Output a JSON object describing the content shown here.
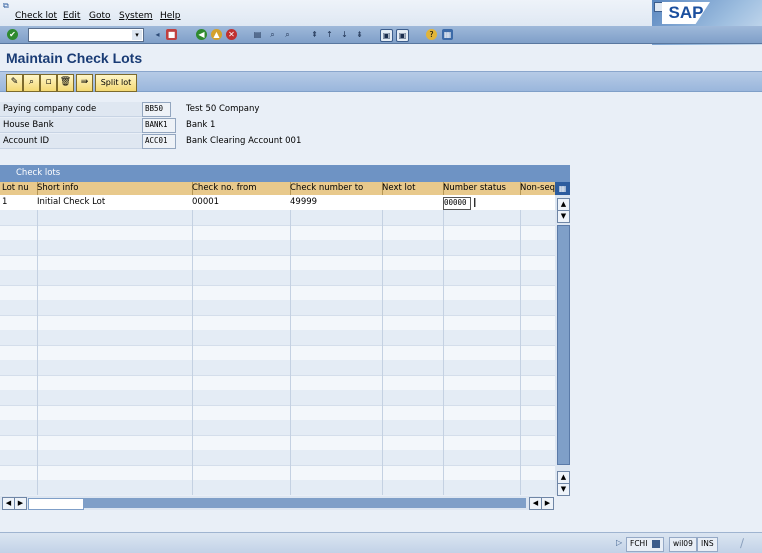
{
  "menu": {
    "items": [
      "Check lot",
      "Edit",
      "Goto",
      "System",
      "Help"
    ]
  },
  "brand": {
    "logo": "SAP"
  },
  "toolbar": {
    "command_field_value": "",
    "icons": [
      "enter-icon",
      "back-icon",
      "exit-icon",
      "cancel-icon",
      "print-icon",
      "find-icon",
      "find-next-icon",
      "first-page-icon",
      "prev-page-icon",
      "next-page-icon",
      "last-page-icon",
      "new-session-icon",
      "shortcut-icon",
      "help-icon",
      "layout-icon"
    ]
  },
  "page": {
    "title": "Maintain Check Lots"
  },
  "app_toolbar": {
    "split_lot_label": "Split lot",
    "icons": [
      "change-icon",
      "display-icon",
      "create-icon",
      "delete-icon",
      "next-icon"
    ]
  },
  "header_fields": {
    "paying_company_code": {
      "label": "Paying company code",
      "value": "BB50",
      "description": "Test 50 Company"
    },
    "house_bank": {
      "label": "House Bank",
      "value": "BANK1",
      "description": "Bank 1"
    },
    "account_id": {
      "label": "Account ID",
      "value": "ACC01",
      "description": "Bank Clearing Account 001"
    }
  },
  "check_lots_table": {
    "title": "Check lots",
    "columns": [
      "Lot nu",
      "Short info",
      "Check no. from",
      "Check number to",
      "Next lot",
      "Number status",
      "Non-seq"
    ],
    "rows": [
      {
        "lot_number": "1",
        "short_info": "Initial Check Lot",
        "check_no_from": "00001",
        "check_number_to": "49999",
        "next_lot": "",
        "number_status": "00000",
        "non_seq": ""
      }
    ]
  },
  "status_bar": {
    "system": "FCHI",
    "server": "wil09",
    "mode": "INS"
  },
  "colors": {
    "title_text": "#1a3c75",
    "table_header": "#e8c98c",
    "table_title_bar": "#6e93c4",
    "toolbar": "#9ab6dc"
  }
}
